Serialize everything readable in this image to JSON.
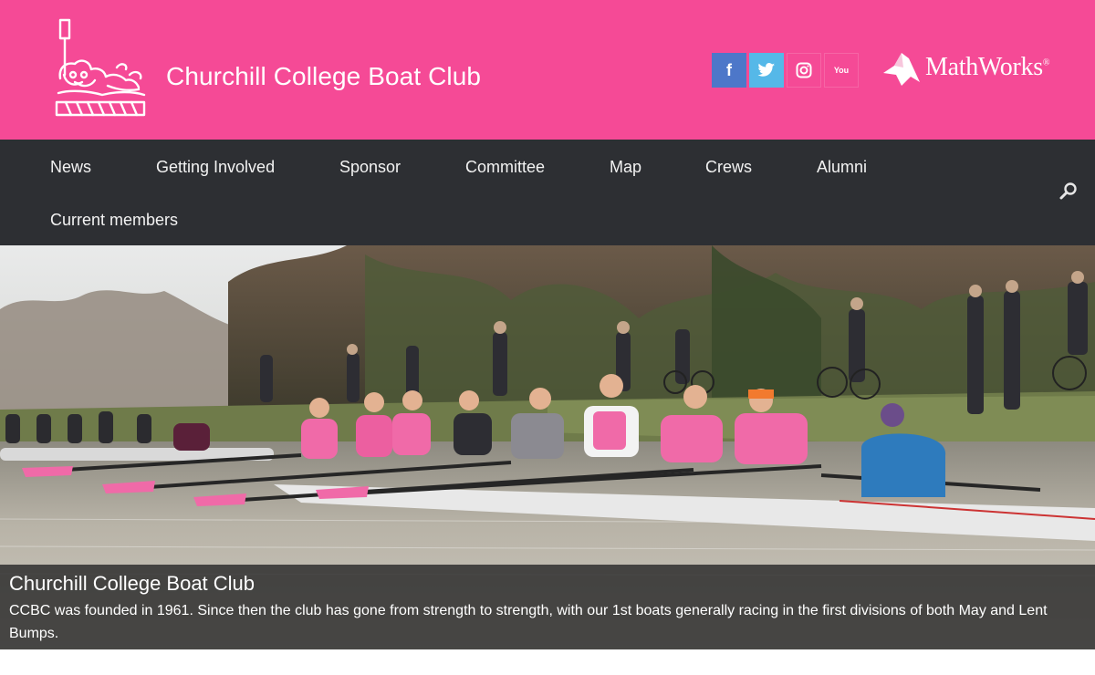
{
  "header": {
    "title": "Churchill College Boat Club",
    "background_color": "#f54a96",
    "social": [
      {
        "name": "facebook",
        "glyph": "f",
        "color": "#4d77c9"
      },
      {
        "name": "twitter",
        "glyph": "t",
        "color": "#55b8e8"
      },
      {
        "name": "instagram",
        "glyph": "",
        "color": "#f54a96"
      },
      {
        "name": "youtube",
        "glyph": "You",
        "color": "#f54a96"
      }
    ],
    "sponsor": {
      "name": "MathWorks",
      "mark": "®"
    }
  },
  "nav": {
    "background_color": "#2d2f33",
    "items": [
      "News",
      "Getting Involved",
      "Sponsor",
      "Committee",
      "Map",
      "Crews",
      "Alumni",
      "Current members"
    ],
    "search_icon": "search-icon"
  },
  "hero": {
    "caption_title": "Churchill College Boat Club",
    "caption_text": "CCBC was founded in 1961. Since then the club has gone from strength to strength, with our 1st boats generally racing in the first divisions of both May and Lent Bumps."
  }
}
